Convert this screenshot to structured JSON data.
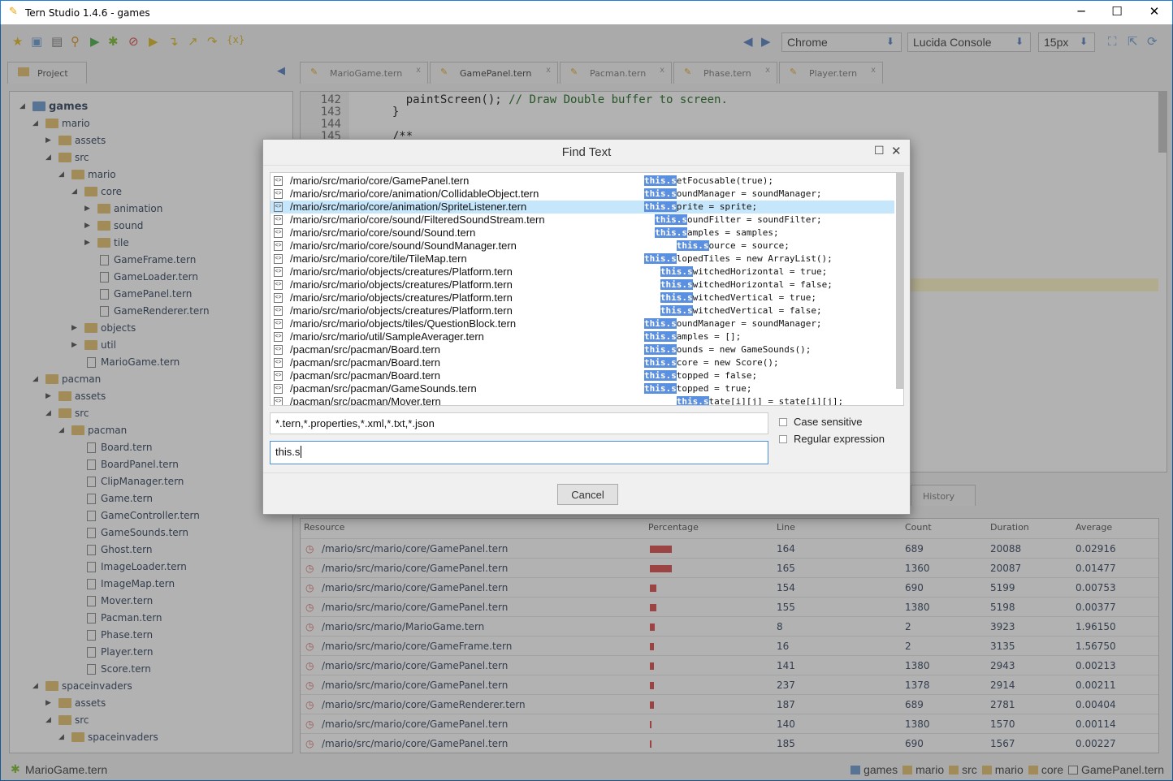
{
  "window": {
    "title": "Tern Studio 1.4.6 - games",
    "minimize": "─",
    "maximize": "☐",
    "close": "✕"
  },
  "toolbar": {
    "browser": "Chrome",
    "font": "Lucida Console",
    "size": "15px"
  },
  "project_tab": "Project",
  "editor_tabs": [
    "MarioGame.tern",
    "GamePanel.tern",
    "Pacman.tern",
    "Phase.tern",
    "Player.tern"
  ],
  "tree": [
    {
      "l": 0,
      "t": "games",
      "k": "folder",
      "o": 1
    },
    {
      "l": 1,
      "t": "mario",
      "k": "folder",
      "o": 1
    },
    {
      "l": 2,
      "t": "assets",
      "k": "folder",
      "o": 0
    },
    {
      "l": 2,
      "t": "src",
      "k": "folder",
      "o": 1
    },
    {
      "l": 3,
      "t": "mario",
      "k": "folder",
      "o": 1
    },
    {
      "l": 4,
      "t": "core",
      "k": "folder",
      "o": 1
    },
    {
      "l": 5,
      "t": "animation",
      "k": "folder",
      "o": 0
    },
    {
      "l": 5,
      "t": "sound",
      "k": "folder",
      "o": 0
    },
    {
      "l": 5,
      "t": "tile",
      "k": "folder",
      "o": 0
    },
    {
      "l": 5,
      "t": "GameFrame.tern",
      "k": "file"
    },
    {
      "l": 5,
      "t": "GameLoader.tern",
      "k": "file"
    },
    {
      "l": 5,
      "t": "GamePanel.tern",
      "k": "file"
    },
    {
      "l": 5,
      "t": "GameRenderer.tern",
      "k": "file"
    },
    {
      "l": 4,
      "t": "objects",
      "k": "folder",
      "o": 0
    },
    {
      "l": 4,
      "t": "util",
      "k": "folder",
      "o": 0
    },
    {
      "l": 4,
      "t": "MarioGame.tern",
      "k": "file"
    },
    {
      "l": 1,
      "t": "pacman",
      "k": "folder",
      "o": 1
    },
    {
      "l": 2,
      "t": "assets",
      "k": "folder",
      "o": 0
    },
    {
      "l": 2,
      "t": "src",
      "k": "folder",
      "o": 1
    },
    {
      "l": 3,
      "t": "pacman",
      "k": "folder",
      "o": 1
    },
    {
      "l": 4,
      "t": "Board.tern",
      "k": "file"
    },
    {
      "l": 4,
      "t": "BoardPanel.tern",
      "k": "file"
    },
    {
      "l": 4,
      "t": "ClipManager.tern",
      "k": "file"
    },
    {
      "l": 4,
      "t": "Game.tern",
      "k": "file"
    },
    {
      "l": 4,
      "t": "GameController.tern",
      "k": "file"
    },
    {
      "l": 4,
      "t": "GameSounds.tern",
      "k": "file"
    },
    {
      "l": 4,
      "t": "Ghost.tern",
      "k": "file"
    },
    {
      "l": 4,
      "t": "ImageLoader.tern",
      "k": "file"
    },
    {
      "l": 4,
      "t": "ImageMap.tern",
      "k": "file"
    },
    {
      "l": 4,
      "t": "Mover.tern",
      "k": "file"
    },
    {
      "l": 4,
      "t": "Pacman.tern",
      "k": "file"
    },
    {
      "l": 4,
      "t": "Phase.tern",
      "k": "file"
    },
    {
      "l": 4,
      "t": "Player.tern",
      "k": "file"
    },
    {
      "l": 4,
      "t": "Score.tern",
      "k": "file"
    },
    {
      "l": 1,
      "t": "spaceinvaders",
      "k": "folder",
      "o": 1
    },
    {
      "l": 2,
      "t": "assets",
      "k": "folder",
      "o": 0
    },
    {
      "l": 2,
      "t": "src",
      "k": "folder",
      "o": 1
    },
    {
      "l": 3,
      "t": "spaceinvaders",
      "k": "folder",
      "o": 1
    }
  ],
  "editor": {
    "lines": [
      {
        "n": "142",
        "c": "    paintScreen(); ",
        "cm": "// Draw Double buffer to screen."
      },
      {
        "n": "143",
        "c": "  }",
        "cm": ""
      },
      {
        "n": "144",
        "c": "",
        "cm": ""
      },
      {
        "n": "145",
        "c": "  /**",
        "cm": ""
      }
    ]
  },
  "bottom_tab": "History",
  "table": {
    "headers": [
      "Resource",
      "Percentage",
      "Line",
      "Count",
      "Duration",
      "Average"
    ],
    "rows": [
      [
        "/mario/src/mario/core/GamePanel.tern",
        18,
        "164",
        "689",
        "20088",
        "0.02916"
      ],
      [
        "/mario/src/mario/core/GamePanel.tern",
        18,
        "165",
        "1360",
        "20087",
        "0.01477"
      ],
      [
        "/mario/src/mario/core/GamePanel.tern",
        5,
        "154",
        "690",
        "5199",
        "0.00753"
      ],
      [
        "/mario/src/mario/core/GamePanel.tern",
        5,
        "155",
        "1380",
        "5198",
        "0.00377"
      ],
      [
        "/mario/src/mario/MarioGame.tern",
        4,
        "8",
        "2",
        "3923",
        "1.96150"
      ],
      [
        "/mario/src/mario/core/GameFrame.tern",
        3,
        "16",
        "2",
        "3135",
        "1.56750"
      ],
      [
        "/mario/src/mario/core/GamePanel.tern",
        3,
        "141",
        "1380",
        "2943",
        "0.00213"
      ],
      [
        "/mario/src/mario/core/GamePanel.tern",
        3,
        "237",
        "1378",
        "2914",
        "0.00211"
      ],
      [
        "/mario/src/mario/core/GameRenderer.tern",
        3,
        "187",
        "689",
        "2781",
        "0.00404"
      ],
      [
        "/mario/src/mario/core/GamePanel.tern",
        1.5,
        "140",
        "1380",
        "1570",
        "0.00114"
      ],
      [
        "/mario/src/mario/core/GamePanel.tern",
        1.5,
        "185",
        "690",
        "1567",
        "0.00227"
      ]
    ]
  },
  "status": {
    "left": "MarioGame.tern",
    "breadcrumb": [
      "games",
      "mario",
      "src",
      "mario",
      "core",
      "GamePanel.tern"
    ]
  },
  "dialog": {
    "title": "Find Text",
    "results": [
      {
        "p": "/mario/src/mario/core/GamePanel.tern",
        "w": "",
        "m": "this.s",
        "r": "etFocusable(true);"
      },
      {
        "p": "/mario/src/mario/core/animation/CollidableObject.tern",
        "w": "",
        "m": "this.s",
        "r": "oundManager = soundManager;"
      },
      {
        "p": "/mario/src/mario/core/animation/SpriteListener.tern",
        "w": "",
        "m": "this.s",
        "r": "prite = sprite;",
        "selected": true
      },
      {
        "p": "/mario/src/mario/core/sound/FilteredSoundStream.tern",
        "w": "  ",
        "m": "this.s",
        "r": "oundFilter = soundFilter;"
      },
      {
        "p": "/mario/src/mario/core/sound/Sound.tern",
        "w": "  ",
        "m": "this.s",
        "r": "amples = samples;"
      },
      {
        "p": "/mario/src/mario/core/sound/SoundManager.tern",
        "w": "      ",
        "m": "this.s",
        "r": "ource = source;"
      },
      {
        "p": "/mario/src/mario/core/tile/TileMap.tern",
        "w": "",
        "m": "this.s",
        "r": "lopedTiles = new ArrayList();"
      },
      {
        "p": "/mario/src/mario/objects/creatures/Platform.tern",
        "w": "   ",
        "m": "this.s",
        "r": "witchedHorizontal = true;"
      },
      {
        "p": "/mario/src/mario/objects/creatures/Platform.tern",
        "w": "   ",
        "m": "this.s",
        "r": "witchedHorizontal = false;"
      },
      {
        "p": "/mario/src/mario/objects/creatures/Platform.tern",
        "w": "   ",
        "m": "this.s",
        "r": "witchedVertical = true;"
      },
      {
        "p": "/mario/src/mario/objects/creatures/Platform.tern",
        "w": "   ",
        "m": "this.s",
        "r": "witchedVertical = false;"
      },
      {
        "p": "/mario/src/mario/objects/tiles/QuestionBlock.tern",
        "w": "",
        "m": "this.s",
        "r": "oundManager = soundManager;"
      },
      {
        "p": "/mario/src/mario/util/SampleAverager.tern",
        "w": "",
        "m": "this.s",
        "r": "amples = [];"
      },
      {
        "p": "/pacman/src/pacman/Board.tern",
        "w": "",
        "m": "this.s",
        "r": "ounds = new GameSounds();"
      },
      {
        "p": "/pacman/src/pacman/Board.tern",
        "w": "",
        "m": "this.s",
        "r": "core = new Score();"
      },
      {
        "p": "/pacman/src/pacman/Board.tern",
        "w": "",
        "m": "this.s",
        "r": "topped = false;"
      },
      {
        "p": "/pacman/src/pacman/GameSounds.tern",
        "w": "",
        "m": "this.s",
        "r": "topped = true;"
      },
      {
        "p": "/pacman/src/pacman/Mover.tern",
        "w": "      ",
        "m": "this.s",
        "r": "tate[i][j] = state[i][j];"
      }
    ],
    "file_filter": "*.tern,*.properties,*.xml,*.txt,*.json",
    "search": "this.s",
    "case_sensitive": "Case sensitive",
    "case_checked": false,
    "regex": "Regular expression",
    "regex_checked": false,
    "cancel": "Cancel"
  },
  "colors": {
    "accent": "#1e7fd8",
    "highlight": "#5b8fe0",
    "selected_row": "#c6e6fb"
  }
}
